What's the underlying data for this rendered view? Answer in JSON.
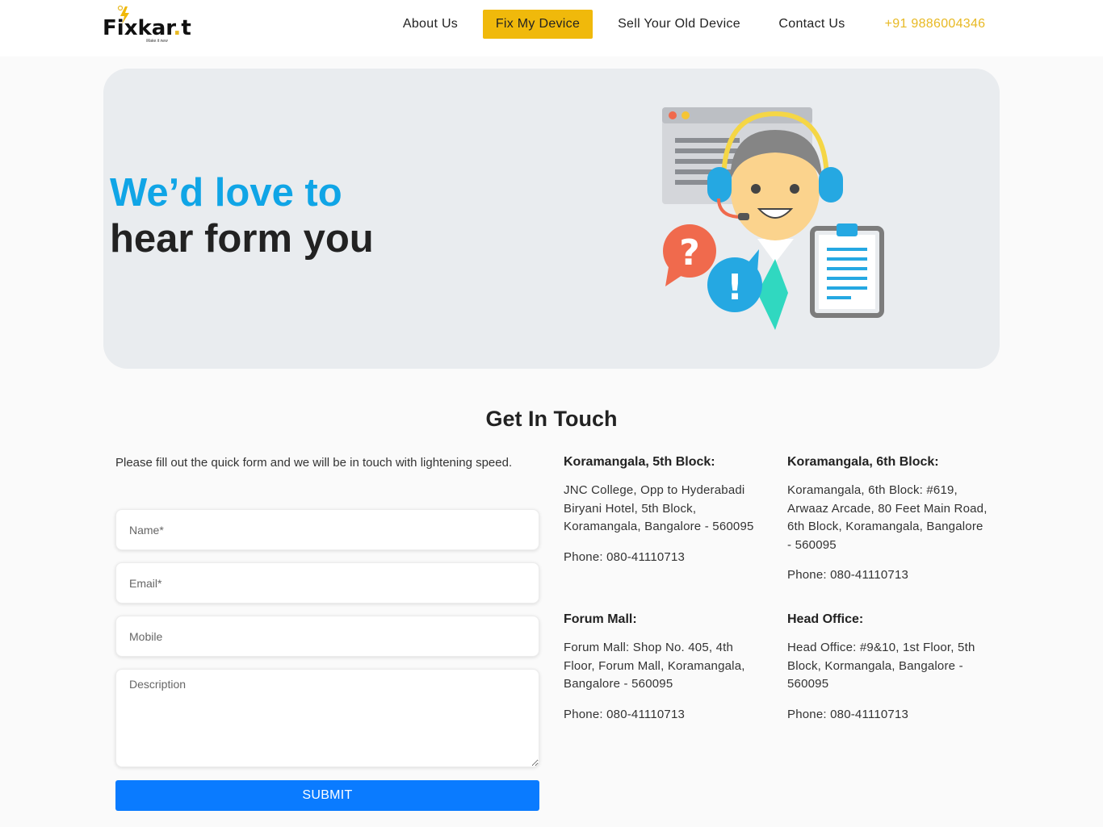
{
  "brand": {
    "name_part1": "Fi",
    "name_part2": "kar",
    "name_dot": ".",
    "name_part3": "t",
    "tagline": "Make it new",
    "accent_color": "#f0b90b"
  },
  "nav": {
    "about": "About Us",
    "fix": "Fix My Device",
    "sell": "Sell Your Old Device",
    "contact": "Contact Us",
    "phone": "+91 9886004346"
  },
  "hero": {
    "line1": "We’d love to",
    "line2": "hear form you",
    "illustration_icon": "customer-support-illustration"
  },
  "section": {
    "title": "Get In Touch"
  },
  "form": {
    "intro": "Please fill out the quick form and we will be in touch with lightening speed.",
    "name_placeholder": "Name*",
    "email_placeholder": "Email*",
    "mobile_placeholder": "Mobile",
    "description_placeholder": "Description",
    "submit_label": "SUBMIT",
    "submit_color": "#0a7bff"
  },
  "offices": [
    {
      "title": "Koramangala, 5th Block:",
      "address": "JNC College, Opp to Hyderabadi Biryani Hotel, 5th Block, Koramangala, Bangalore - 560095",
      "phone": "Phone: 080-41110713"
    },
    {
      "title": "Koramangala, 6th Block:",
      "address": "Koramangala, 6th Block: #619, Arwaaz Arcade, 80 Feet Main Road, 6th Block, Koramangala, Bangalore - 560095",
      "phone": "Phone: 080-41110713"
    },
    {
      "title": "Forum Mall:",
      "address": "Forum Mall: Shop No. 405, 4th Floor, Forum Mall, Koramangala, Bangalore - 560095",
      "phone": "Phone: 080-41110713"
    },
    {
      "title": "Head Office:",
      "address": "Head Office: #9&10, 1st Floor, 5th Block, Kormangala, Bangalore - 560095",
      "phone": "Phone: 080-41110713"
    }
  ]
}
